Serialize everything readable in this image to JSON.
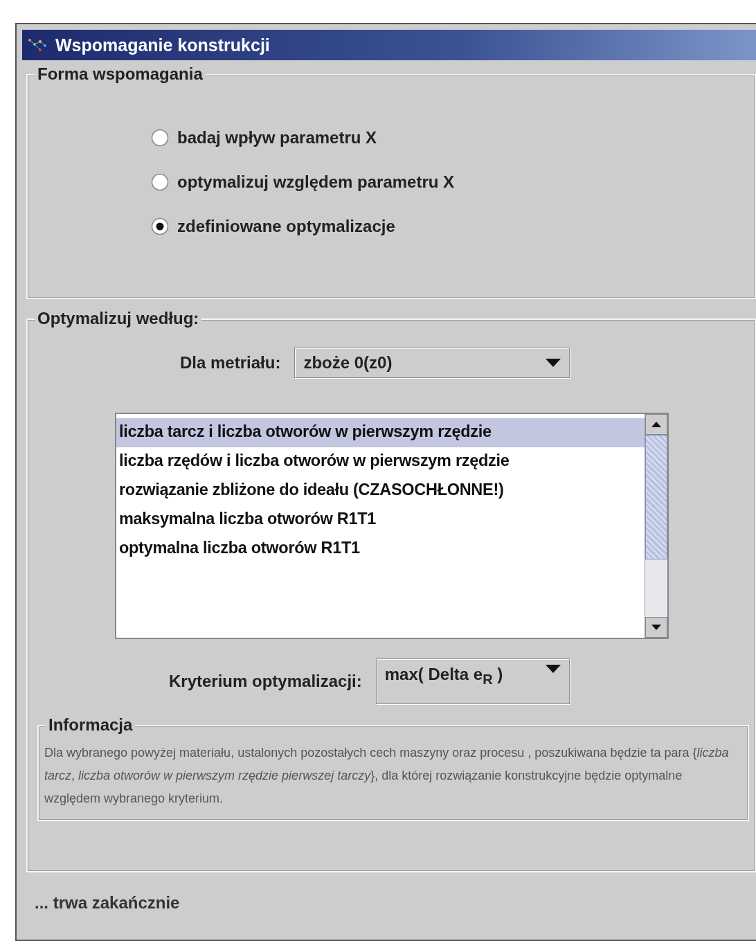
{
  "window": {
    "title": "Wspomaganie konstrukcji"
  },
  "support_form": {
    "title": "Forma wspomagania",
    "options": [
      {
        "label": "badaj wpływ parametru X",
        "selected": false
      },
      {
        "label": "optymalizuj względem parametru X",
        "selected": false
      },
      {
        "label": "zdefiniowane optymalizacje",
        "selected": true
      }
    ]
  },
  "optimize": {
    "title": "Optymalizuj według:",
    "material": {
      "label": "Dla metriału:",
      "value": "zboże 0(z0)"
    },
    "items": [
      {
        "label": "liczba tarcz i liczba otworów w pierwszym rzędzie",
        "selected": true
      },
      {
        "label": "liczba rzędów i liczba otworów w pierwszym rzędzie",
        "selected": false
      },
      {
        "label": "rozwiązanie zbliżone do ideału (CZASOCHŁONNE!)",
        "selected": false
      },
      {
        "label": "maksymalna liczba otworów R1T1",
        "selected": false
      },
      {
        "label": "optymalna liczba otworów R1T1",
        "selected": false
      }
    ],
    "criterion": {
      "label": "Kryterium optymalizacji:",
      "value": "max( Delta e$_{R}$ )"
    },
    "info": {
      "title": "Informacja",
      "text": "Dla wybranego powyżej materiału, ustalonych pozostałych cech maszyny oraz procesu , poszukiwana będzie ta para {*liczba tarcz*, *liczba otworów w pierwszym rzędzie pierwszej tarczy*}, dla której rozwiązanie konstrukcyjne będzie optymalne względem wybranego kryterium."
    }
  },
  "status_bar": "... trwa zakańcznie"
}
